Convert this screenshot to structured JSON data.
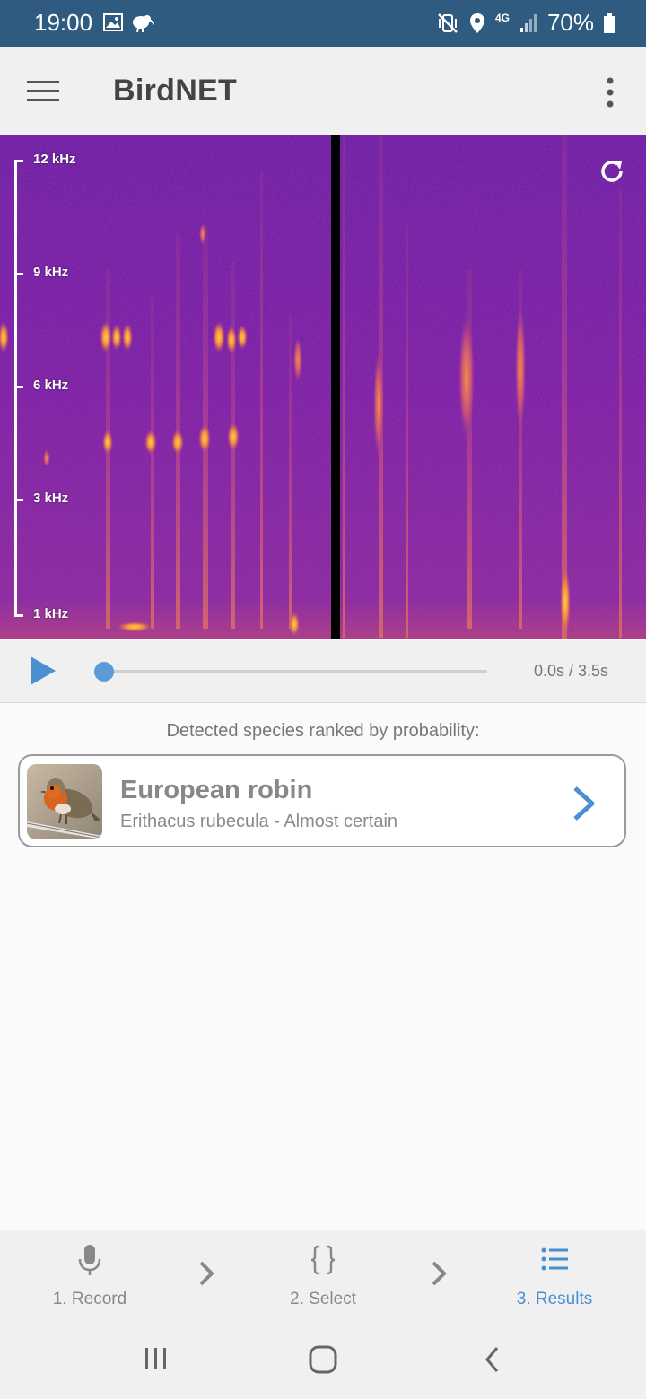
{
  "status_bar": {
    "time": "19:00",
    "left_icons": [
      "gallery-icon",
      "kiwi-icon"
    ],
    "right_icons": [
      "vibrate-mute-icon",
      "location-icon",
      "4g-icon",
      "signal-icon",
      "battery-icon"
    ],
    "network": "4G",
    "battery": "70%"
  },
  "app_bar": {
    "title": "BirdNET",
    "menu_icon": "hamburger-menu-icon",
    "more_icon": "more-vertical-icon"
  },
  "spectrogram": {
    "frequency_ticks": [
      "12 kHz",
      "9 kHz",
      "6 kHz",
      "3 kHz",
      "1 kHz"
    ],
    "refresh_icon": "refresh-icon"
  },
  "player": {
    "play_icon": "play-icon",
    "time": "0.0s / 3.5s",
    "progress": 0.0
  },
  "results": {
    "heading": "Detected species ranked by probability:",
    "species": [
      {
        "common_name": "European robin",
        "detail": "Erithacus rubecula - Almost certain",
        "chevron_icon": "chevron-right-icon"
      }
    ]
  },
  "steps": [
    {
      "label": "1. Record",
      "icon": "microphone-icon",
      "active": false
    },
    {
      "label": "2. Select",
      "icon": "braces-icon",
      "active": false
    },
    {
      "label": "3. Results",
      "icon": "list-icon",
      "active": true
    }
  ],
  "colors": {
    "status_bar": "#2f5b80",
    "accent": "#5b9bd5",
    "step_inactive": "#888888"
  }
}
